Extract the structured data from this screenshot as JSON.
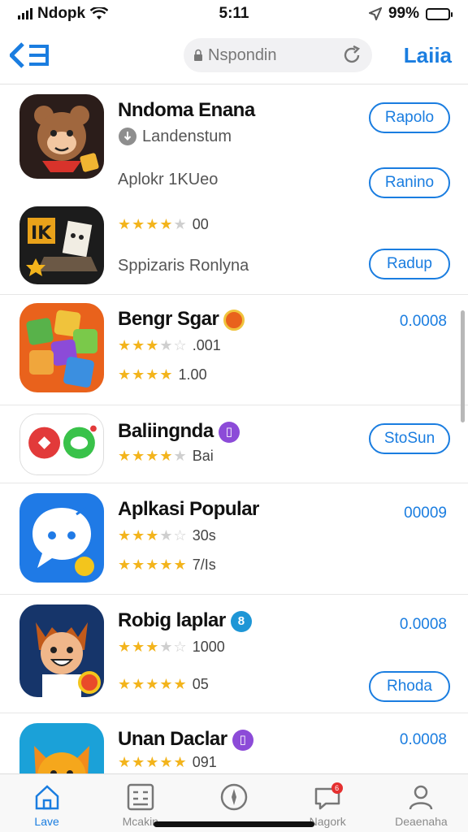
{
  "status_bar": {
    "carrier": "Ndopk",
    "time": "5:11",
    "battery": "99%",
    "battery_level": 0.95
  },
  "navbar": {
    "back_icon": "back-arrow-icon",
    "search_text": "Nspondin",
    "right_label": "Laiia"
  },
  "apps": [
    {
      "title": "Nndoma Enana",
      "line1": "Landenstum",
      "line2": "Aplokr 1KUeo",
      "button1": "Rapolo",
      "button2": "Ranino"
    },
    {
      "rating_text": "00",
      "stars": 4,
      "subtitle": "Sppizaris Ronlyna",
      "button": "Radup"
    },
    {
      "title": "Bengr Sgar",
      "rating1_text": ".001",
      "rating2_text": "1.00",
      "stars1": 3.5,
      "stars2": 4,
      "price": "0.0008"
    },
    {
      "title": "Baliingnda",
      "rating_text": "Bai",
      "stars": 4,
      "button": "StoSun"
    },
    {
      "title": "Aplkasi Popular",
      "rating1_text": "30s",
      "rating2_text": "7/Is",
      "stars1": 3.5,
      "stars2": 5,
      "price": "00009"
    },
    {
      "title": "Robig laplar",
      "rating1_text": "1000",
      "rating2_text": "05",
      "stars1": 3.5,
      "stars2": 5,
      "price": "0.0008",
      "button": "Rhoda"
    },
    {
      "title": "Unan Daclar",
      "rating_text": "091",
      "stars": 5,
      "price": "0.0008"
    }
  ],
  "tabs": [
    {
      "label": "Lave",
      "icon": "home-icon"
    },
    {
      "label": "Mcakin",
      "icon": "grid-icon"
    },
    {
      "label": "",
      "icon": "compass-icon"
    },
    {
      "label": "Nagork",
      "icon": "chat-icon",
      "badge": "6"
    },
    {
      "label": "Deaenaha",
      "icon": "person-icon"
    }
  ],
  "colors": {
    "accent": "#1a7de0",
    "star": "#f3b41c",
    "divider": "#e6e6e6"
  }
}
